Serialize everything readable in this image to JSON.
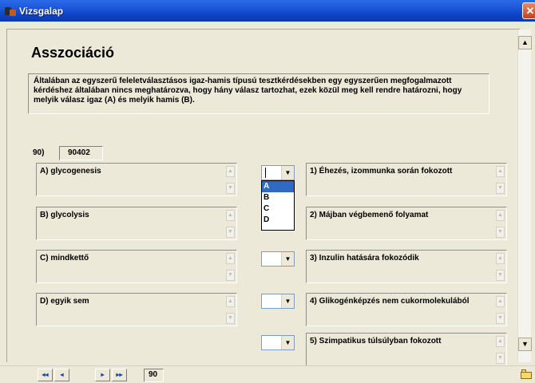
{
  "window": {
    "title": "Vizsgalap",
    "close_glyph": "✕"
  },
  "page": {
    "title": "Asszociáció",
    "description": "Általában az egyszerű feleletválasztásos igaz-hamis típusú tesztkérdésekben egy egyszerűen megfogalmazott kérdéshez általában nincs meghatározva, hogy hány válasz tartozhat, ezek közül meg kell rendre határozni, hogy melyik válasz igaz (A) és melyik hamis (B).",
    "question_number": "90)",
    "question_code": "90402"
  },
  "left_options": [
    {
      "label": "A) glycogenesis"
    },
    {
      "label": "B) glycolysis"
    },
    {
      "label": "C) mindkettő"
    },
    {
      "label": "D) egyik sem"
    }
  ],
  "statements": [
    {
      "label": "1) Éhezés, izommunka során fokozott",
      "selected": ""
    },
    {
      "label": "2) Májban végbemenő folyamat",
      "selected": ""
    },
    {
      "label": "3) Inzulin hatására fokozódik",
      "selected": ""
    },
    {
      "label": "4) Glikogénképzés nem cukormolekulából",
      "selected": ""
    },
    {
      "label": "5) Szimpatikus túlsúlyban fokozott",
      "selected": ""
    }
  ],
  "dropdown": {
    "options": [
      "A",
      "B",
      "C",
      "D"
    ],
    "highlighted": "A"
  },
  "navigation": {
    "first": "◂◂",
    "prev": "◂",
    "next": "▸",
    "last": "▸▸",
    "page_number": "90"
  },
  "icons": {
    "scroll_up": "▲",
    "scroll_down": "▼",
    "combo_arrow": "▼",
    "app": "app-icon",
    "folder": "folder-icon"
  },
  "colors": {
    "titlebar": "#0d43c7",
    "selection": "#316ac5",
    "background": "#ece9d8"
  }
}
